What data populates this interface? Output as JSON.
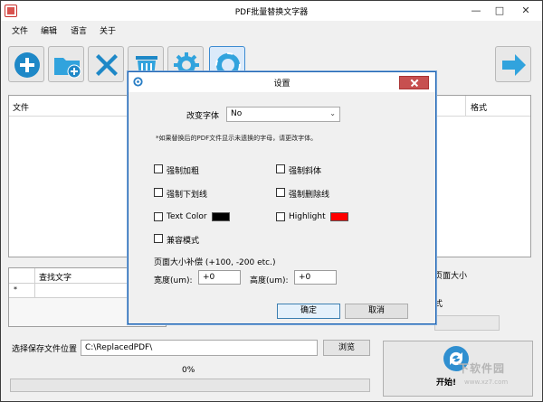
{
  "app": {
    "title": "PDF批量替换文字器",
    "window_controls": {
      "minimize": "—",
      "maximize": "□",
      "close": "✕"
    }
  },
  "menu": {
    "items": [
      "文件",
      "编辑",
      "语言",
      "关于"
    ]
  },
  "toolbar": {
    "buttons": [
      {
        "name": "add",
        "icon": "plus-icon",
        "color": "#1e88c7"
      },
      {
        "name": "add-folder",
        "icon": "folder-plus-icon",
        "color": "#31a3dd"
      },
      {
        "name": "remove",
        "icon": "x-icon",
        "color": "#1e88c7"
      },
      {
        "name": "clear",
        "icon": "trash-icon",
        "color": "#31a3dd"
      },
      {
        "name": "settings",
        "icon": "gear-icon",
        "color": "#31a3dd"
      },
      {
        "name": "help",
        "icon": "lifebuoy-icon",
        "color": "#31a3dd"
      },
      {
        "name": "next",
        "icon": "arrow-right-icon",
        "color": "#31a3dd"
      }
    ]
  },
  "file_table": {
    "headers": [
      "文件",
      "格式"
    ]
  },
  "search_grid": {
    "header": "查找文字",
    "row_marker": "*"
  },
  "right_panel": {
    "label1": "页面大小",
    "label2": "式"
  },
  "save": {
    "label": "选择保存文件位置",
    "path": "C:\\ReplacedPDF\\",
    "browse": "浏览"
  },
  "progress": {
    "text": "0%",
    "value": 0
  },
  "start": {
    "label": "开始!"
  },
  "watermark": {
    "text": "下软件园",
    "sub": "www.xz7.com"
  },
  "dialog": {
    "title": "设置",
    "font_label": "改变字体",
    "font_value": "No",
    "note": "*如果替换后的PDF文件显示未遗换的字母，请更改字体。",
    "checkboxes": {
      "bold": "强制加粗",
      "italic": "强制斜体",
      "underline": "强制下划线",
      "strikethrough": "强制删除线",
      "text_color": "Text Color",
      "highlight": "Highlight",
      "compat": "兼容模式"
    },
    "colors": {
      "text_color": "#000000",
      "highlight": "#ff0000"
    },
    "page_size_label": "页面大小补偿 (+100, -200 etc.)",
    "width_label": "宽度(um):",
    "width_value": "+0",
    "height_label": "高度(um):",
    "height_value": "+0",
    "ok": "确定",
    "cancel": "取消"
  }
}
